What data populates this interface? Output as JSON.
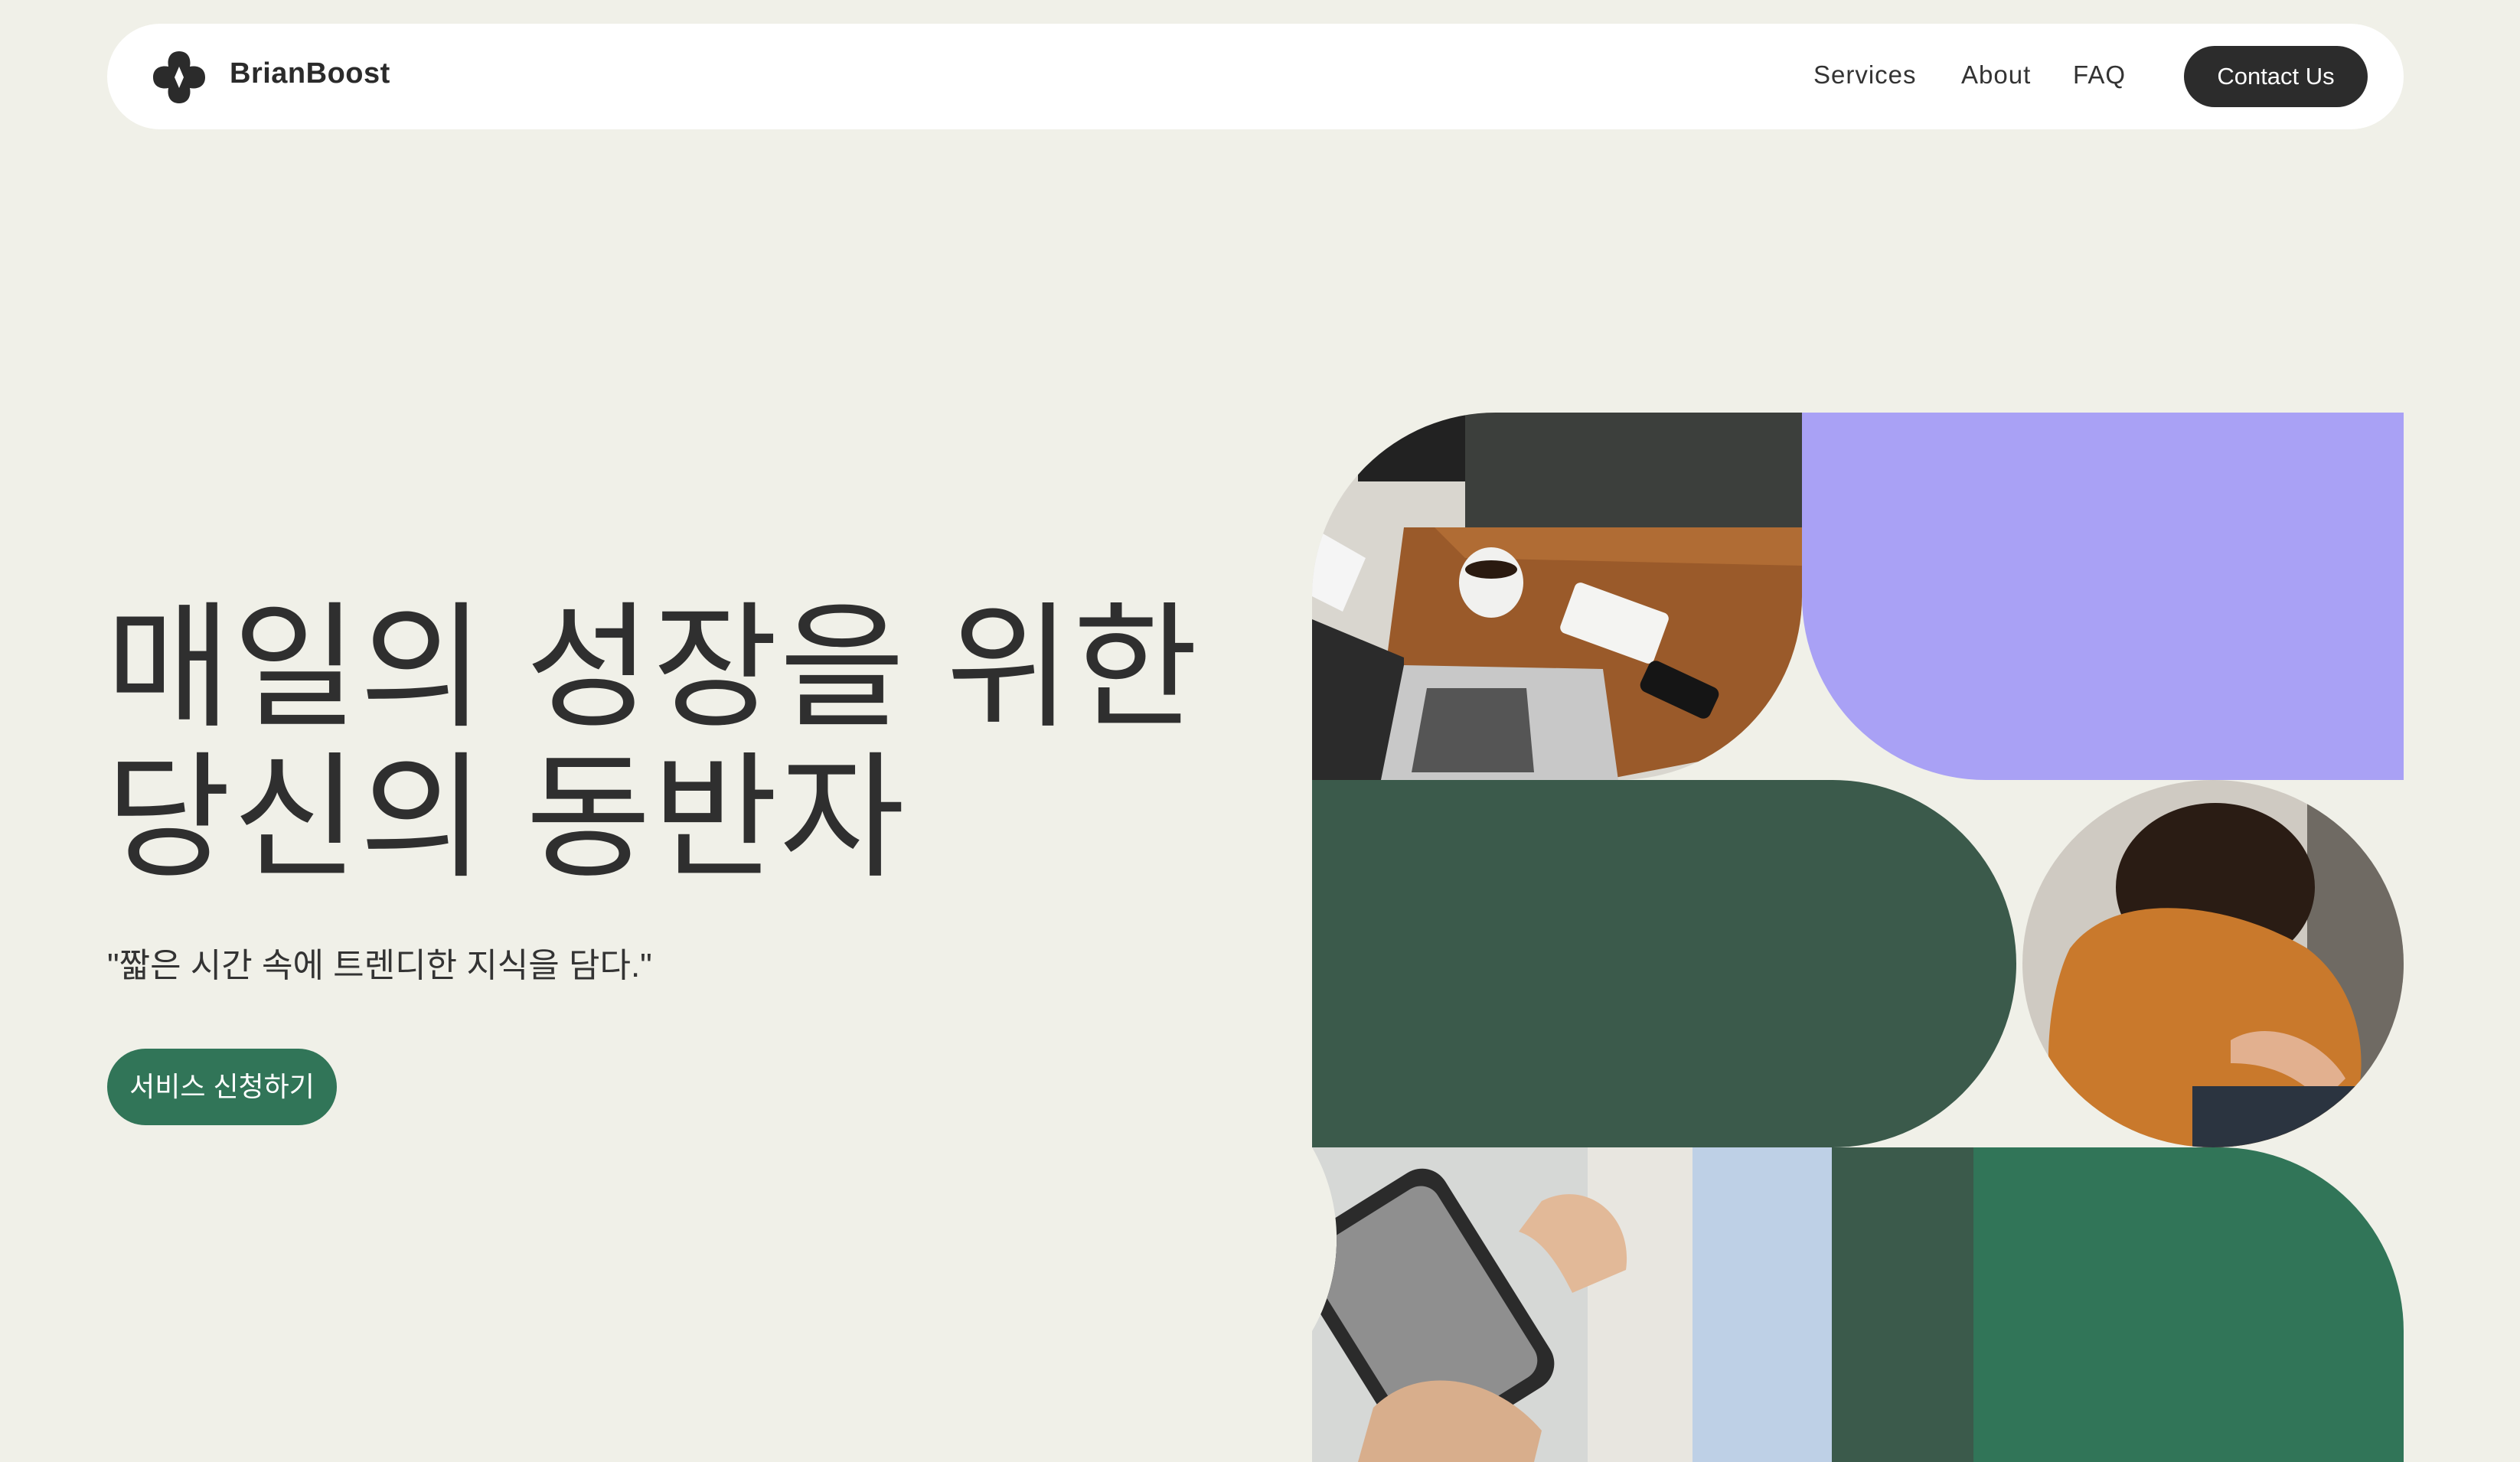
{
  "nav": {
    "brand": "BrianBoost",
    "links": [
      "Services",
      "About",
      "FAQ"
    ],
    "contact_label": "Contact Us"
  },
  "hero": {
    "title_lines": [
      "매일의 성장을 위한",
      "당신의 동반자"
    ],
    "subtitle": "\"짧은 시간 속에 트렌디한 지식을 담다.\"",
    "cta_label": "서비스 신청하기"
  },
  "collage": {
    "images": [
      "desk-laptop-coffee-photo",
      "person-orange-sweater-photo",
      "hand-smartphone-photo"
    ],
    "colors": {
      "lavender": "#a9a1f5",
      "dark_green": "#3b5a4b",
      "green": "#317558",
      "light_blue": "#bed0e6",
      "background": "#f0f0e8"
    }
  },
  "icons": {
    "logo": "four-petal-logo-icon"
  }
}
